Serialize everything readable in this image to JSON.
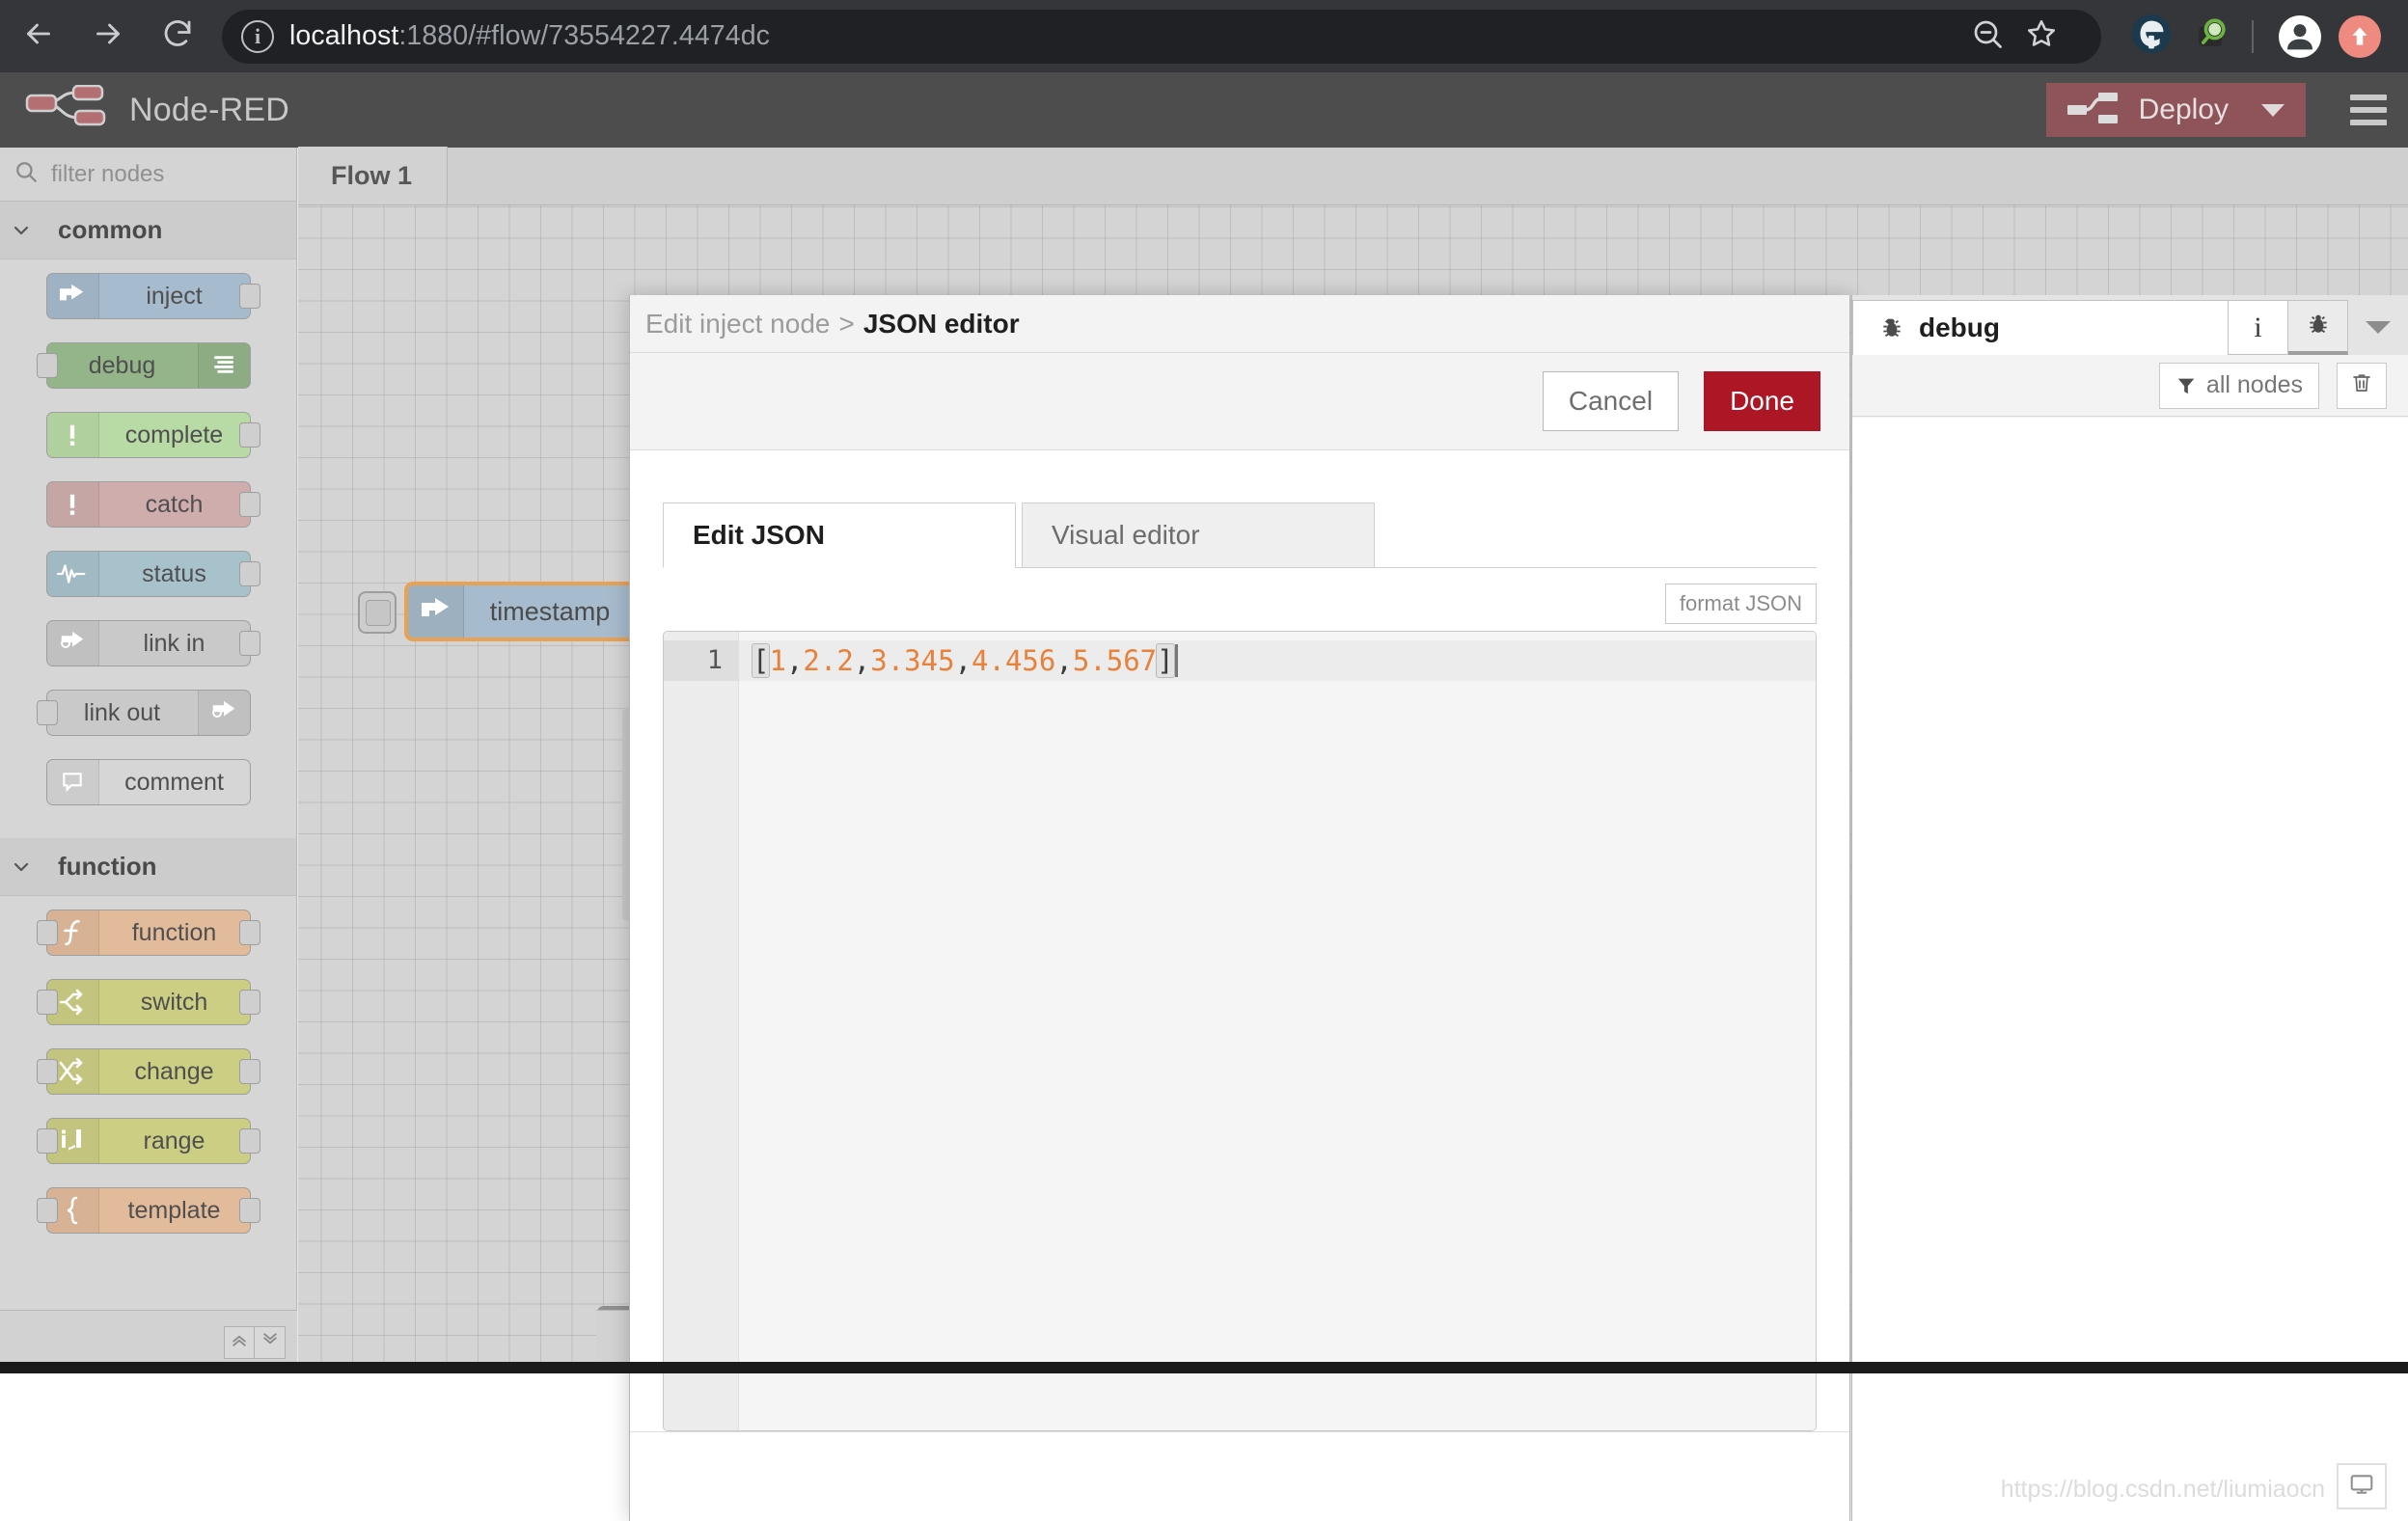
{
  "browser": {
    "url_host": "localhost",
    "url_rest": ":1880/#flow/73554227.4474dc",
    "back_icon": "back-arrow-icon",
    "forward_icon": "forward-arrow-icon",
    "reload_icon": "reload-icon",
    "info_icon": "site-info-icon",
    "zoom_out_icon": "zoom-out-icon",
    "bookmark_icon": "star-icon",
    "ext_edge_icon": "extension-edge-icon",
    "ext_search_icon": "extension-magnifier-icon",
    "profile_icon": "profile-avatar-icon",
    "update_icon": "update-arrow-icon"
  },
  "nr_header": {
    "title": "Node-RED",
    "deploy_label": "Deploy",
    "deploy_color": "#8f5459",
    "menu_icon": "hamburger-menu-icon"
  },
  "palette": {
    "search_placeholder": "filter nodes",
    "search_icon": "search-icon",
    "categories": [
      {
        "name": "common",
        "collapse_icon": "chevron-down-icon",
        "nodes": [
          {
            "label": "inject",
            "color": "#a6bbcd",
            "icon": "inject-arrow-icon",
            "icon_side": "left",
            "ports": [
              "out"
            ]
          },
          {
            "label": "debug",
            "color": "#94b489",
            "icon": "debug-lines-icon",
            "icon_side": "right",
            "ports": [
              "in"
            ]
          },
          {
            "label": "complete",
            "color": "#b8dba5",
            "icon": "exclamation-icon",
            "icon_side": "left",
            "ports": [
              "out"
            ]
          },
          {
            "label": "catch",
            "color": "#cfadad",
            "icon": "exclamation-icon",
            "icon_side": "left",
            "ports": [
              "out"
            ]
          },
          {
            "label": "status",
            "color": "#a8c2cc",
            "icon": "pulse-wave-icon",
            "icon_side": "left",
            "ports": [
              "out"
            ]
          },
          {
            "label": "link in",
            "color": "#c9c9c9",
            "icon": "link-in-icon",
            "icon_side": "left",
            "ports": [
              "out"
            ]
          },
          {
            "label": "link out",
            "color": "#c9c9c9",
            "icon": "link-out-icon",
            "icon_side": "right",
            "ports": [
              "in"
            ]
          },
          {
            "label": "comment",
            "color": "#d6d6d6",
            "icon": "comment-bubble-icon",
            "icon_side": "left",
            "ports": []
          }
        ]
      },
      {
        "name": "function",
        "collapse_icon": "chevron-down-icon",
        "nodes": [
          {
            "label": "function",
            "color": "#e2bb9b",
            "icon": "function-f-icon",
            "icon_side": "left",
            "ports": [
              "in",
              "out"
            ]
          },
          {
            "label": "switch",
            "color": "#ccce84",
            "icon": "switch-branch-icon",
            "icon_side": "left",
            "ports": [
              "in",
              "out"
            ]
          },
          {
            "label": "change",
            "color": "#ccce84",
            "icon": "change-swap-icon",
            "icon_side": "left",
            "ports": [
              "in",
              "out"
            ]
          },
          {
            "label": "range",
            "color": "#ccce84",
            "icon": "range-bars-icon",
            "icon_side": "left",
            "ports": [
              "in",
              "out"
            ]
          },
          {
            "label": "template",
            "color": "#e2bb9b",
            "icon": "brace-icon",
            "icon_side": "left",
            "ports": [
              "in",
              "out"
            ]
          }
        ]
      }
    ],
    "footer": {
      "collapse_all_icon": "double-chevron-up-icon",
      "expand_all_icon": "double-chevron-down-icon"
    }
  },
  "flow": {
    "tab_label": "Flow 1",
    "node": {
      "label": "timestamp",
      "icon": "inject-arrow-icon",
      "color": "#a6bbcd",
      "selected_outline": "#e8a253"
    }
  },
  "dialog": {
    "breadcrumb_parent": "Edit inject node",
    "breadcrumb_separator": ">",
    "breadcrumb_current": "JSON editor",
    "cancel_label": "Cancel",
    "done_label": "Done",
    "done_color": "#ad1625",
    "tabs": [
      {
        "label": "Edit JSON",
        "active": true
      },
      {
        "label": "Visual editor",
        "active": false
      }
    ],
    "format_button_label": "format JSON",
    "editor": {
      "line_number": "1",
      "raw_value": "[1,2.2,3.345,4.456,5.567]",
      "tokens": [
        {
          "text": "[",
          "type": "bracket"
        },
        {
          "text": "1",
          "type": "number"
        },
        {
          "text": ",",
          "type": "punct"
        },
        {
          "text": "2.2",
          "type": "number"
        },
        {
          "text": ",",
          "type": "punct"
        },
        {
          "text": "3.345",
          "type": "number"
        },
        {
          "text": ",",
          "type": "punct"
        },
        {
          "text": "4.456",
          "type": "number"
        },
        {
          "text": ",",
          "type": "punct"
        },
        {
          "text": "5.567",
          "type": "number"
        },
        {
          "text": "]",
          "type": "bracket"
        }
      ],
      "number_color": "#e8813a",
      "punct_color": "#3b3b3b"
    }
  },
  "sidebar_right": {
    "tab_label": "debug",
    "tab_icon": "bug-icon",
    "info_button_label": "i",
    "debug_button_icon": "bug-icon",
    "more_icon": "caret-down-icon",
    "filter_label": "all nodes",
    "filter_icon": "funnel-icon",
    "clear_icon": "trash-icon",
    "messages": []
  },
  "overlay": {
    "watermark_text": "https://blog.csdn.net/liumiaocn",
    "monitor_icon": "monitor-icon"
  }
}
